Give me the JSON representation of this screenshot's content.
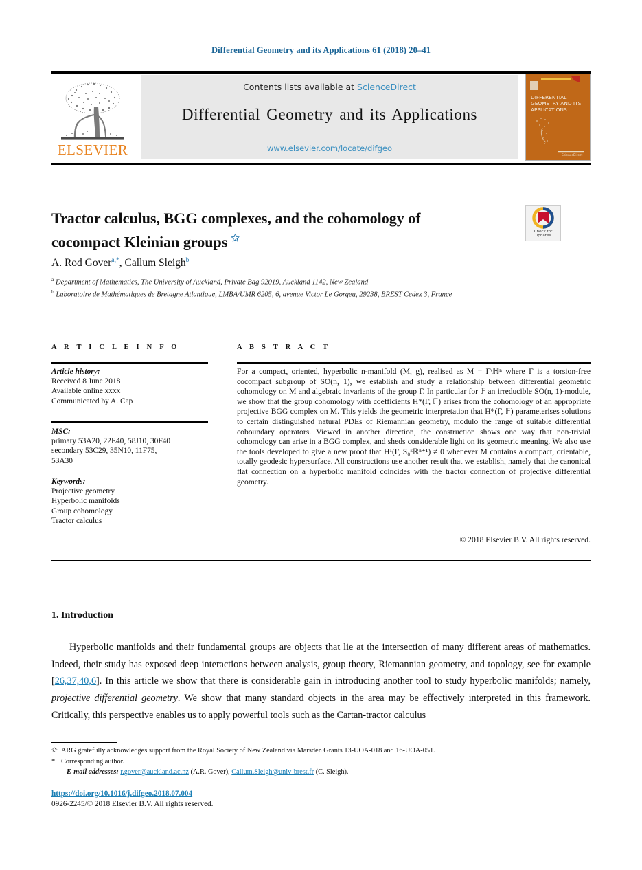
{
  "running_head": "Differential Geometry and its Applications 61 (2018) 20–41",
  "masthead": {
    "contents_prefix": "Contents lists available at ",
    "sciencedirect": "ScienceDirect",
    "journal_title": "Differential Geometry and its Applications",
    "journal_url": "www.elsevier.com/locate/difgeo",
    "publisher_logo": "elsevier-tree-logo",
    "publisher_name": "ELSEVIER",
    "cover_title_lines": [
      "DIFFERENTIAL",
      "GEOMETRY AND ITS",
      "APPLICATIONS"
    ],
    "accent_color": "#3a8fc0",
    "cover_color": "#c06818"
  },
  "article": {
    "title": "Tractor calculus, BGG complexes, and the cohomology of cocompact Kleinian groups",
    "title_footnote_mark": "✩",
    "authors": "A. Rod Gover",
    "author_marks_1": "a,*",
    "author_2": ", Callum Sleigh",
    "author_marks_2": "b",
    "affiliation_a_mark": "a",
    "affiliation_a": "Department of Mathematics, The University of Auckland, Private Bag 92019, Auckland 1142, New Zealand",
    "affiliation_b_mark": "b",
    "affiliation_b": "Laboratoire de Mathématiques de Bretagne Atlantique, LMBA/UMR 6205, 6, avenue Victor Le Gorgeu, 29238, BREST Cedex 3, France"
  },
  "crossmark": {
    "line1": "Check for",
    "line2": "updates",
    "icon": "crossmark-check-for-updates-icon"
  },
  "info": {
    "heading": "A R T I C L E    I N F O",
    "history_label": "Article history:",
    "history": [
      "Received 8 June 2018",
      "Available online xxxx",
      "Communicated by A. Cap"
    ],
    "msc_label": "MSC:",
    "msc": [
      "primary 53A20, 22E40, 58J10, 30F40",
      "secondary 53C29, 35N10, 11F75,",
      "53A30"
    ],
    "keywords_label": "Keywords:",
    "keywords": [
      "Projective geometry",
      "Hyperbolic manifolds",
      "Group cohomology",
      "Tractor calculus"
    ]
  },
  "abstract": {
    "heading": "A B S T R A C T",
    "text": "For a compact, oriented, hyperbolic n-manifold (M, g), realised as M = Γ\\ℍⁿ where Γ is a torsion-free cocompact subgroup of SO(n, 1), we establish and study a relationship between differential geometric cohomology on M and algebraic invariants of the group Γ. In particular for 𝔽 an irreducible SO(n, 1)-module, we show that the group cohomology with coefficients H*(Γ, 𝔽) arises from the cohomology of an appropriate projective BGG complex on M. This yields the geometric interpretation that H*(Γ, 𝔽) parameterises solutions to certain distinguished natural PDEs of Riemannian geometry, modulo the range of suitable differential coboundary operators. Viewed in another direction, the construction shows one way that non-trivial cohomology can arise in a BGG complex, and sheds considerable light on its geometric meaning. We also use the tools developed to give a new proof that H¹(Γ, S₀ᵏℝⁿ⁺¹) ≠ 0 whenever M contains a compact, orientable, totally geodesic hypersurface. All constructions use another result that we establish, namely that the canonical flat connection on a hyperbolic manifold coincides with the tractor connection of projective differential geometry.",
    "copyright": "© 2018 Elsevier B.V. All rights reserved."
  },
  "body": {
    "section_number_title": "1. Introduction",
    "paragraph_part1": "Hyperbolic manifolds and their fundamental groups are objects that lie at the intersection of many different areas of mathematics. Indeed, their study has exposed deep interactions between analysis, group theory, Riemannian geometry, and topology, see for example [",
    "citation": "26,37,40,6",
    "paragraph_part2": "]. In this article we show that there is considerable gain in introducing another tool to study hyperbolic manifolds; namely, ",
    "emphasis_1": "projective differential geometry",
    "paragraph_part3": ". We show that many standard objects in the area may be effectively interpreted in this framework. Critically, this perspective enables us to apply powerful tools such as the Cartan-tractor calculus"
  },
  "footnotes": {
    "mark_star_open": "✩",
    "note_funding": "ARG gratefully acknowledges support from the Royal Society of New Zealand via Marsden Grants 13-UOA-018 and 16-UOA-051.",
    "mark_asterisk": "*",
    "note_corresponding": "Corresponding author.",
    "email_label": "E-mail addresses:",
    "email_1": "r.gover@auckland.ac.nz",
    "email_1_owner": "(A.R. Gover),",
    "email_2": "Callum.Sleigh@univ-brest.fr",
    "email_2_owner": "(C. Sleigh)."
  },
  "doi": {
    "url": "https://doi.org/10.1016/j.difgeo.2018.07.004",
    "issn_line": "0926-2245/© 2018 Elsevier B.V. All rights reserved."
  }
}
